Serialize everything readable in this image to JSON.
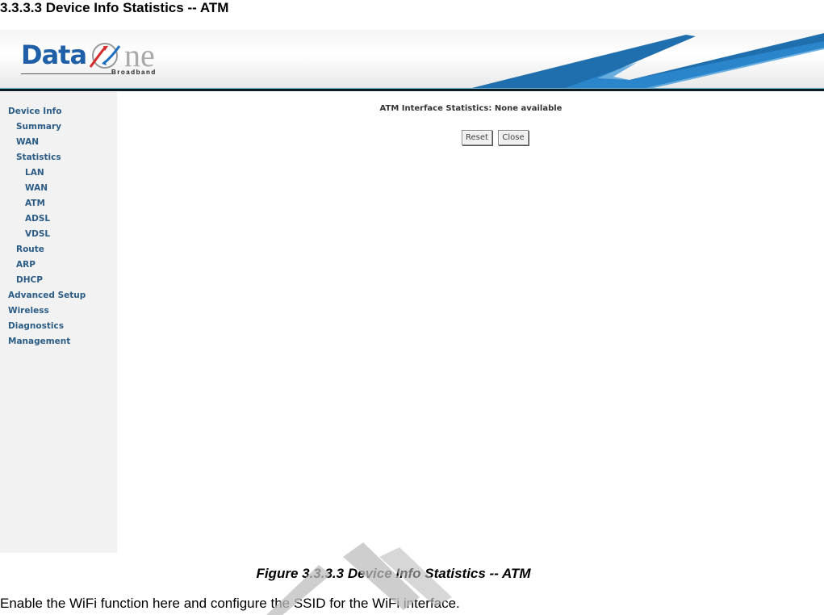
{
  "document": {
    "section_heading": "3.3.3.3 Device Info Statistics -- ATM",
    "figure_caption": "Figure 3.3.3.3 Device Info Statistics -- ATM",
    "body_text": "Enable the WiFi function here and configure the SSID for the WiFi interface."
  },
  "banner": {
    "logo_data": "Data",
    "logo_one": "ne",
    "logo_tagline": "Broadband",
    "brand_color": "#1e5fa8",
    "swoosh_color": "#1f6fae"
  },
  "sidebar": {
    "items": [
      {
        "label": "Device Info",
        "level": 0
      },
      {
        "label": "Summary",
        "level": 1
      },
      {
        "label": "WAN",
        "level": 1
      },
      {
        "label": "Statistics",
        "level": 1
      },
      {
        "label": "LAN",
        "level": 2
      },
      {
        "label": "WAN",
        "level": 2
      },
      {
        "label": "ATM",
        "level": 2
      },
      {
        "label": "ADSL",
        "level": 2
      },
      {
        "label": "VDSL",
        "level": 2
      },
      {
        "label": "Route",
        "level": 1
      },
      {
        "label": "ARP",
        "level": 1
      },
      {
        "label": "DHCP",
        "level": 1
      },
      {
        "label": "Advanced Setup",
        "level": 0
      },
      {
        "label": "Wireless",
        "level": 0
      },
      {
        "label": "Diagnostics",
        "level": 0
      },
      {
        "label": "Management",
        "level": 0
      }
    ]
  },
  "main": {
    "message": "ATM Interface Statistics: None available",
    "buttons": {
      "reset": "Reset",
      "close": "Close"
    }
  }
}
